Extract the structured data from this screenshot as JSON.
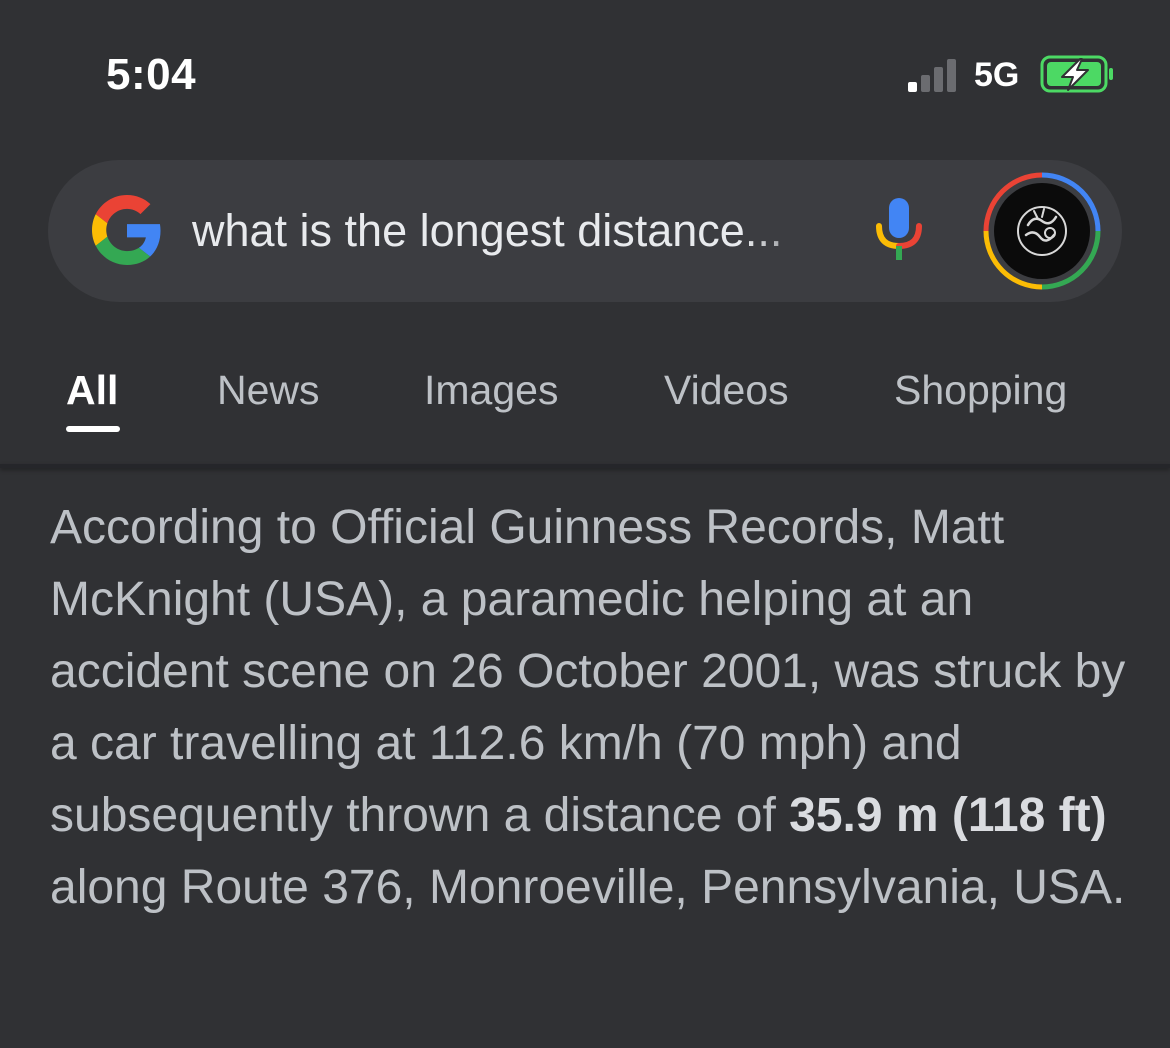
{
  "status_bar": {
    "time": "5:04",
    "network": "5G",
    "signal_icon": "cellular-signal-icon",
    "battery_icon": "battery-charging-icon",
    "battery_color": "#4cd964"
  },
  "search": {
    "query": "what is the longest distance...",
    "logo": "google-g-logo",
    "mic_icon": "microphone-icon",
    "avatar_icon": "profile-avatar-icon",
    "brand_colors": {
      "blue": "#4285f4",
      "red": "#ea4335",
      "yellow": "#fbbc05",
      "green": "#34a853"
    }
  },
  "tabs": [
    {
      "label": "All",
      "active": true
    },
    {
      "label": "News",
      "active": false
    },
    {
      "label": "Images",
      "active": false
    },
    {
      "label": "Videos",
      "active": false
    },
    {
      "label": "Shopping",
      "active": false
    }
  ],
  "snippet": {
    "before_bold": "According to Official Guinness Records, Matt McKnight (USA), a paramedic helping at an accident scene on 26 October 2001, was struck by a car travelling at 112.6 km/h (70 mph) and subsequently thrown a distance of ",
    "bold": "35.9 m (118 ft)",
    "after_bold": " along Route 376, Monroeville, Pennsylvania, USA."
  }
}
